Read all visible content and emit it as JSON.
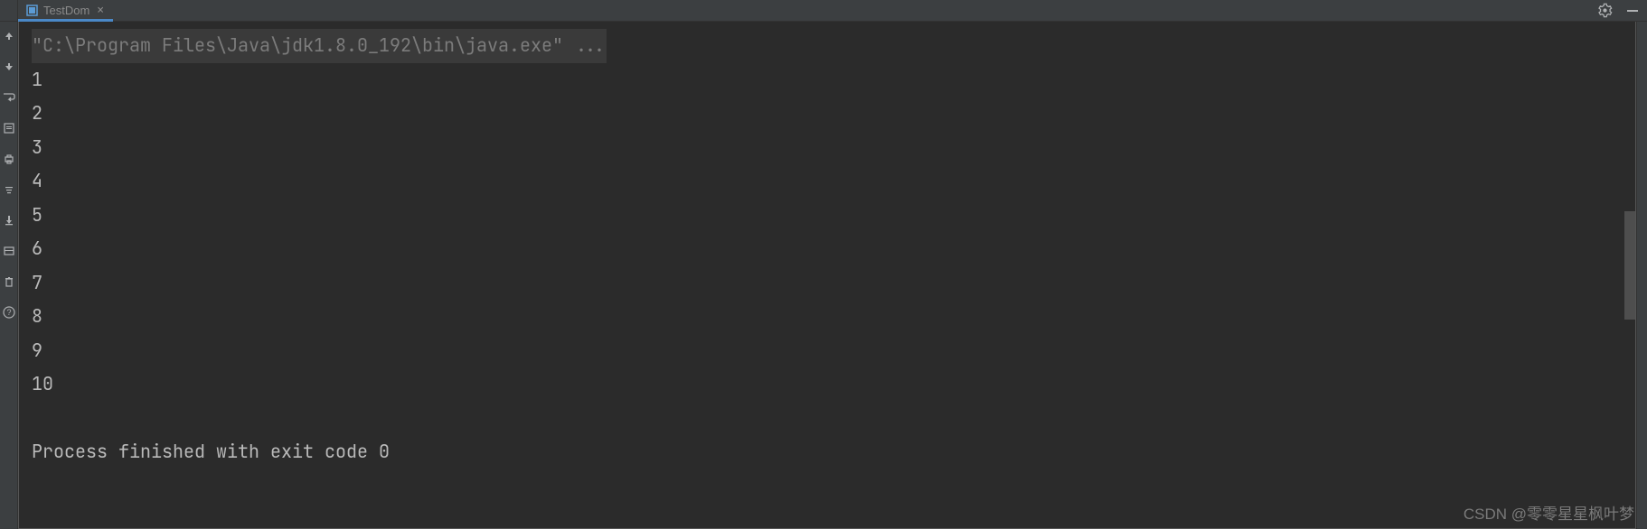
{
  "tab": {
    "label": "TestDom",
    "close": "×"
  },
  "console": {
    "command": "\"C:\\Program Files\\Java\\jdk1.8.0_192\\bin\\java.exe\" ...",
    "output_lines": [
      "1",
      "2",
      "3",
      "4",
      "5",
      "6",
      "7",
      "8",
      "9",
      "10"
    ],
    "finish_line": "Process finished with exit code 0"
  },
  "watermark": "CSDN @零零星星枫叶梦"
}
